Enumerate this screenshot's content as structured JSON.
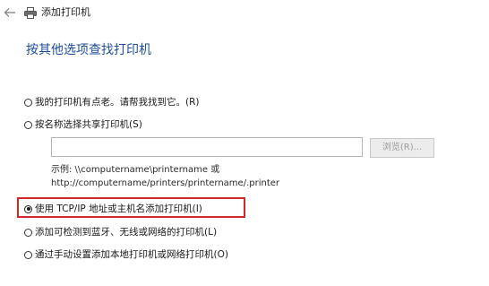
{
  "window": {
    "title": "添加打印机"
  },
  "heading": "按其他选项查找打印机",
  "options": [
    {
      "label": "我的打印机有点老。请帮我找到它。(R)",
      "checked": false
    },
    {
      "label": "按名称选择共享打印机(S)",
      "checked": false
    },
    {
      "label": "使用 TCP/IP 地址或主机名添加打印机(I)",
      "checked": true
    },
    {
      "label": "添加可检测到蓝牙、无线或网络的打印机(L)",
      "checked": false
    },
    {
      "label": "通过手动设置添加本地打印机或网络打印机(O)",
      "checked": false
    }
  ],
  "share": {
    "input_value": "",
    "browse_label": "浏览(R)...",
    "example_line1": "示例: \\\\computername\\printername 或",
    "example_line2": "http://computername/printers/printername/.printer"
  },
  "colors": {
    "heading": "#1f4e9c",
    "highlight": "#cf2a2a"
  },
  "icons": {
    "back": "back-arrow-icon",
    "printer": "printer-icon"
  }
}
